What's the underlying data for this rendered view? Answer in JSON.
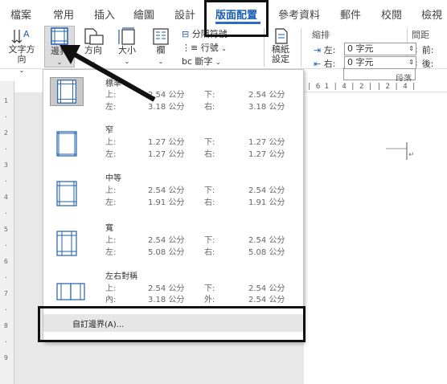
{
  "tabs": [
    "檔案",
    "常用",
    "插入",
    "繪圖",
    "設計",
    "版面配置",
    "參考資料",
    "郵件",
    "校閱",
    "檢視"
  ],
  "active_tab": "版面配置",
  "ribbon": {
    "text_direction": "文字方向",
    "margins": "邊界",
    "orientation": "方向",
    "size": "大小",
    "columns": "欄",
    "breaks": "分隔符號",
    "line_numbers": "行號",
    "hyphenation": "斷字",
    "manuscript": "稿紙設定",
    "indent_group": "縮排",
    "indent_left_label": "左:",
    "indent_left_value": "0 字元",
    "indent_right_label": "右:",
    "indent_right_value": "0 字元",
    "spacing_group": "間距",
    "spacing_before_label": "前:",
    "spacing_after_label": "後:",
    "paragraph_group": "段落"
  },
  "ruler_h_text": "| 6 1 | 4 | 2 | | 2 | 4 |",
  "margins_menu": {
    "items": [
      {
        "name": "標準",
        "top_label": "上:",
        "top": "2.54 公分",
        "bottom_label": "下:",
        "bottom": "2.54 公分",
        "left_label": "左:",
        "left": "3.18 公分",
        "right_label": "右:",
        "right": "3.18 公分",
        "selected": true
      },
      {
        "name": "窄",
        "top_label": "上:",
        "top": "1.27 公分",
        "bottom_label": "下:",
        "bottom": "1.27 公分",
        "left_label": "左:",
        "left": "1.27 公分",
        "right_label": "右:",
        "right": "1.27 公分",
        "selected": false
      },
      {
        "name": "中等",
        "top_label": "上:",
        "top": "2.54 公分",
        "bottom_label": "下:",
        "bottom": "2.54 公分",
        "left_label": "左:",
        "left": "1.91 公分",
        "right_label": "右:",
        "right": "1.91 公分",
        "selected": false
      },
      {
        "name": "寬",
        "top_label": "上:",
        "top": "2.54 公分",
        "bottom_label": "下:",
        "bottom": "2.54 公分",
        "left_label": "左:",
        "left": "5.08 公分",
        "right_label": "右:",
        "right": "5.08 公分",
        "selected": false
      },
      {
        "name": "左右對稱",
        "top_label": "上:",
        "top": "2.54 公分",
        "bottom_label": "下:",
        "bottom": "2.54 公分",
        "left_label": "內:",
        "left": "3.18 公分",
        "right_label": "外:",
        "right": "2.54 公分",
        "selected": false
      }
    ],
    "custom": "自訂邊界(A)..."
  },
  "colors": {
    "accent": "#2b6cc4",
    "thumb": "#1f5fae",
    "highlight": "#111111"
  }
}
